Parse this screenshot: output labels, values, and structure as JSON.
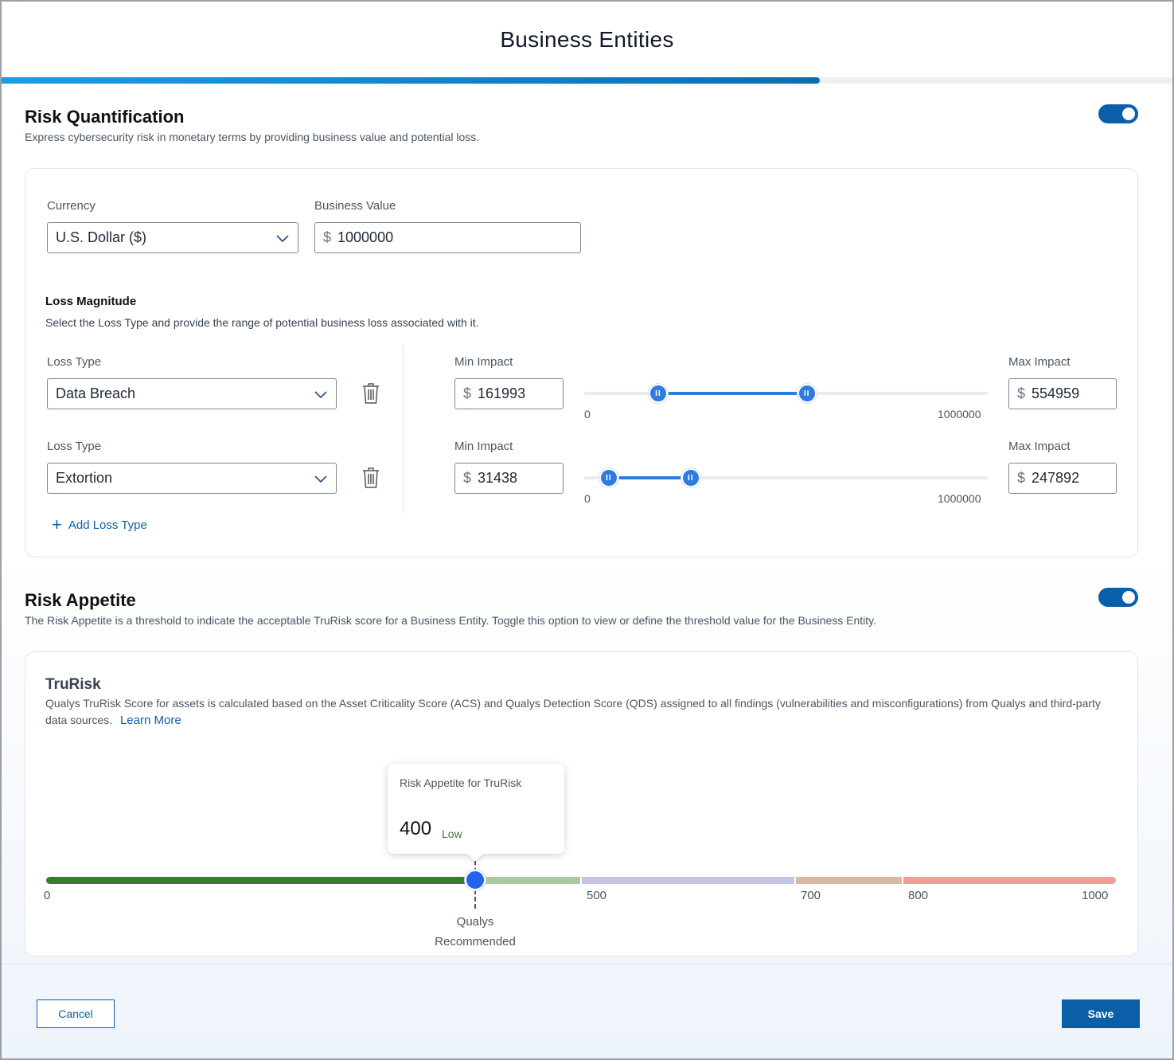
{
  "header": {
    "title": "Business Entities",
    "progress_fraction": 0.697
  },
  "risk_quantification": {
    "title": "Risk Quantification",
    "description": "Express cybersecurity risk in monetary terms by providing business value and potential loss.",
    "enabled": true,
    "currency": {
      "label": "Currency",
      "value": "U.S. Dollar ($)"
    },
    "business_value": {
      "label": "Business Value",
      "symbol": "$",
      "value": "1000000"
    },
    "loss_magnitude": {
      "title": "Loss Magnitude",
      "description": "Select the Loss Type and provide the range of potential business loss associated with it.",
      "rows": [
        {
          "loss_type_label": "Loss Type",
          "loss_type": "Data Breach",
          "min_label": "Min Impact",
          "min_symbol": "$",
          "min_value": "161993",
          "max_label": "Max Impact",
          "max_symbol": "$",
          "max_value": "554959",
          "range_min": "0",
          "range_max": "1000000",
          "slider_min": 161993,
          "slider_max": 554959,
          "slider_total": 1000000
        },
        {
          "loss_type_label": "Loss Type",
          "loss_type": "Extortion",
          "min_label": "Min Impact",
          "min_symbol": "$",
          "min_value": "31438",
          "max_label": "Max Impact",
          "max_symbol": "$",
          "max_value": "247892",
          "range_min": "0",
          "range_max": "1000000",
          "slider_min": 31438,
          "slider_max": 247892,
          "slider_total": 1000000
        }
      ],
      "add_loss_type": "Add Loss Type"
    }
  },
  "risk_appetite": {
    "title": "Risk Appetite",
    "description": "The Risk Appetite is a threshold to indicate the acceptable TruRisk score for a Business Entity. Toggle this option to view or define the threshold value for the Business Entity.",
    "enabled": true,
    "trurisk": {
      "title": "TruRisk",
      "description": "Qualys TruRisk Score for assets is calculated based on the Asset Criticality Score (ACS) and Qualys Detection Score (QDS) assigned to all findings (vulnerabilities and misconfigurations) from Qualys and third-party data sources.",
      "learn_more": "Learn More",
      "tooltip_title": "Risk Appetite for TruRisk",
      "value": "400",
      "level": "Low",
      "score": 400,
      "scale_max": 1000,
      "scale_labels": [
        "0",
        "500",
        "700",
        "800",
        "1000"
      ],
      "recommended_line1": "Qualys",
      "recommended_line2": "Recommended",
      "colors": {
        "selected": "#3a7a31",
        "low": "#a9c9a0",
        "medium": "#c6c3e3",
        "high": "#d9b8a3",
        "critical": "#ef9e95"
      }
    }
  },
  "footer": {
    "cancel": "Cancel",
    "save": "Save"
  }
}
